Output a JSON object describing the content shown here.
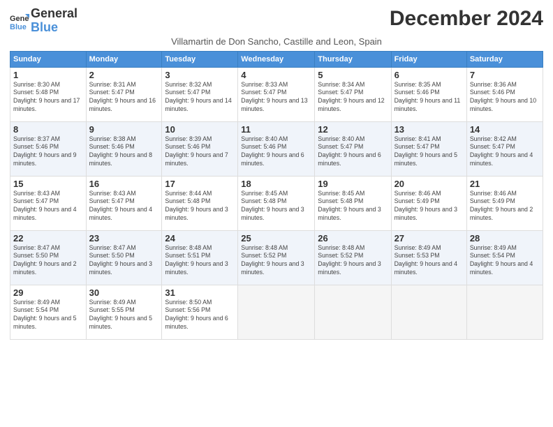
{
  "logo": {
    "general": "General",
    "blue": "Blue"
  },
  "title": "December 2024",
  "subtitle": "Villamartin de Don Sancho, Castille and Leon, Spain",
  "headers": [
    "Sunday",
    "Monday",
    "Tuesday",
    "Wednesday",
    "Thursday",
    "Friday",
    "Saturday"
  ],
  "weeks": [
    [
      {
        "day": "1",
        "sunrise": "8:30 AM",
        "sunset": "5:48 PM",
        "daylight": "9 hours and 17 minutes."
      },
      {
        "day": "2",
        "sunrise": "8:31 AM",
        "sunset": "5:47 PM",
        "daylight": "9 hours and 16 minutes."
      },
      {
        "day": "3",
        "sunrise": "8:32 AM",
        "sunset": "5:47 PM",
        "daylight": "9 hours and 14 minutes."
      },
      {
        "day": "4",
        "sunrise": "8:33 AM",
        "sunset": "5:47 PM",
        "daylight": "9 hours and 13 minutes."
      },
      {
        "day": "5",
        "sunrise": "8:34 AM",
        "sunset": "5:47 PM",
        "daylight": "9 hours and 12 minutes."
      },
      {
        "day": "6",
        "sunrise": "8:35 AM",
        "sunset": "5:46 PM",
        "daylight": "9 hours and 11 minutes."
      },
      {
        "day": "7",
        "sunrise": "8:36 AM",
        "sunset": "5:46 PM",
        "daylight": "9 hours and 10 minutes."
      }
    ],
    [
      {
        "day": "8",
        "sunrise": "8:37 AM",
        "sunset": "5:46 PM",
        "daylight": "9 hours and 9 minutes."
      },
      {
        "day": "9",
        "sunrise": "8:38 AM",
        "sunset": "5:46 PM",
        "daylight": "9 hours and 8 minutes."
      },
      {
        "day": "10",
        "sunrise": "8:39 AM",
        "sunset": "5:46 PM",
        "daylight": "9 hours and 7 minutes."
      },
      {
        "day": "11",
        "sunrise": "8:40 AM",
        "sunset": "5:46 PM",
        "daylight": "9 hours and 6 minutes."
      },
      {
        "day": "12",
        "sunrise": "8:40 AM",
        "sunset": "5:47 PM",
        "daylight": "9 hours and 6 minutes."
      },
      {
        "day": "13",
        "sunrise": "8:41 AM",
        "sunset": "5:47 PM",
        "daylight": "9 hours and 5 minutes."
      },
      {
        "day": "14",
        "sunrise": "8:42 AM",
        "sunset": "5:47 PM",
        "daylight": "9 hours and 4 minutes."
      }
    ],
    [
      {
        "day": "15",
        "sunrise": "8:43 AM",
        "sunset": "5:47 PM",
        "daylight": "9 hours and 4 minutes."
      },
      {
        "day": "16",
        "sunrise": "8:43 AM",
        "sunset": "5:47 PM",
        "daylight": "9 hours and 4 minutes."
      },
      {
        "day": "17",
        "sunrise": "8:44 AM",
        "sunset": "5:48 PM",
        "daylight": "9 hours and 3 minutes."
      },
      {
        "day": "18",
        "sunrise": "8:45 AM",
        "sunset": "5:48 PM",
        "daylight": "9 hours and 3 minutes."
      },
      {
        "day": "19",
        "sunrise": "8:45 AM",
        "sunset": "5:48 PM",
        "daylight": "9 hours and 3 minutes."
      },
      {
        "day": "20",
        "sunrise": "8:46 AM",
        "sunset": "5:49 PM",
        "daylight": "9 hours and 3 minutes."
      },
      {
        "day": "21",
        "sunrise": "8:46 AM",
        "sunset": "5:49 PM",
        "daylight": "9 hours and 2 minutes."
      }
    ],
    [
      {
        "day": "22",
        "sunrise": "8:47 AM",
        "sunset": "5:50 PM",
        "daylight": "9 hours and 2 minutes."
      },
      {
        "day": "23",
        "sunrise": "8:47 AM",
        "sunset": "5:50 PM",
        "daylight": "9 hours and 3 minutes."
      },
      {
        "day": "24",
        "sunrise": "8:48 AM",
        "sunset": "5:51 PM",
        "daylight": "9 hours and 3 minutes."
      },
      {
        "day": "25",
        "sunrise": "8:48 AM",
        "sunset": "5:52 PM",
        "daylight": "9 hours and 3 minutes."
      },
      {
        "day": "26",
        "sunrise": "8:48 AM",
        "sunset": "5:52 PM",
        "daylight": "9 hours and 3 minutes."
      },
      {
        "day": "27",
        "sunrise": "8:49 AM",
        "sunset": "5:53 PM",
        "daylight": "9 hours and 4 minutes."
      },
      {
        "day": "28",
        "sunrise": "8:49 AM",
        "sunset": "5:54 PM",
        "daylight": "9 hours and 4 minutes."
      }
    ],
    [
      {
        "day": "29",
        "sunrise": "8:49 AM",
        "sunset": "5:54 PM",
        "daylight": "9 hours and 5 minutes."
      },
      {
        "day": "30",
        "sunrise": "8:49 AM",
        "sunset": "5:55 PM",
        "daylight": "9 hours and 5 minutes."
      },
      {
        "day": "31",
        "sunrise": "8:50 AM",
        "sunset": "5:56 PM",
        "daylight": "9 hours and 6 minutes."
      },
      null,
      null,
      null,
      null
    ]
  ]
}
